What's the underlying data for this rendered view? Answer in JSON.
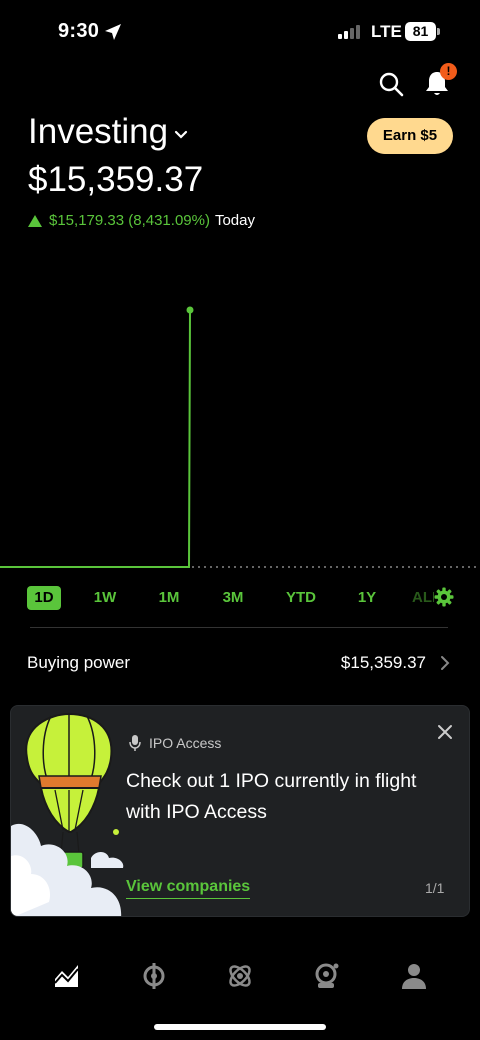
{
  "status": {
    "time": "9:30",
    "network": "LTE",
    "battery": "81"
  },
  "header": {
    "search_icon": "search-icon",
    "notification_icon": "bell-icon",
    "notification_badge": "!"
  },
  "account": {
    "title": "Investing",
    "earn_label": "Earn $5",
    "balance": "$15,359.37",
    "change": "$15,179.33 (8,431.09%)",
    "change_period": "Today",
    "change_color": "#5ac53b"
  },
  "chart": {
    "line_color": "#5ac53b",
    "baseline_style": "dotted"
  },
  "ranges": {
    "items": [
      "1D",
      "1W",
      "1M",
      "3M",
      "YTD",
      "1Y",
      "ALL"
    ],
    "selected": "1D"
  },
  "buying_power": {
    "label": "Buying power",
    "value": "$15,359.37"
  },
  "ipo_card": {
    "tag": "IPO Access",
    "message": "Check out 1 IPO currently in flight with IPO Access",
    "link": "View companies",
    "pager": "1/1",
    "accent": "#5ac53b"
  },
  "nav": {
    "items": [
      "home-icon",
      "crypto-icon",
      "network-icon",
      "retirement-icon",
      "account-icon"
    ]
  }
}
